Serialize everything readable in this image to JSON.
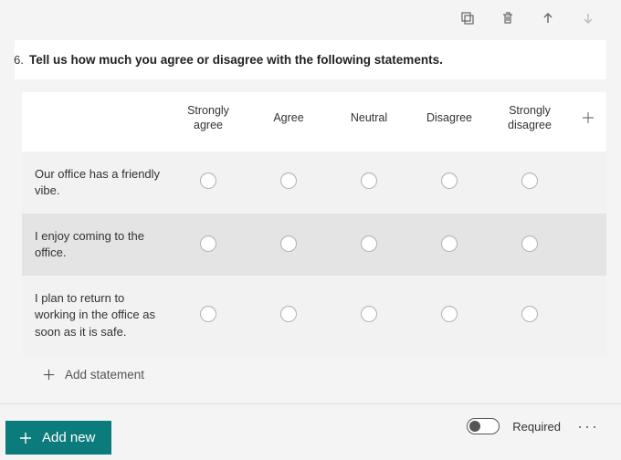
{
  "question": {
    "number": "6.",
    "text": "Tell us how much you agree or disagree with the following statements."
  },
  "matrix": {
    "columns": [
      "Strongly agree",
      "Agree",
      "Neutral",
      "Disagree",
      "Strongly disagree"
    ],
    "rows": [
      "Our office has a friendly vibe.",
      "I enjoy coming to the office.",
      "I plan to return to working in the office as soon as it is safe."
    ]
  },
  "addStatement": "Add statement",
  "requiredLabel": "Required",
  "addNew": "Add new"
}
